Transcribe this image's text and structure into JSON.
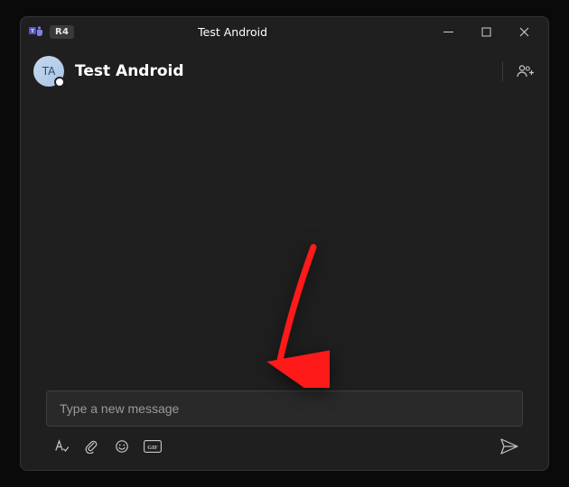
{
  "titlebar": {
    "app_badge": "R4",
    "title": "Test Android"
  },
  "chat_header": {
    "avatar_initials": "TA",
    "contact_name": "Test Android"
  },
  "composer": {
    "placeholder": "Type a new message",
    "value": ""
  },
  "icons": {
    "teams_logo": "teams-logo",
    "minimize": "minimize",
    "maximize": "maximize",
    "close": "close",
    "add_people": "add-people",
    "format": "format",
    "attach": "attach",
    "emoji": "emoji",
    "gif": "GIF",
    "send": "send"
  },
  "annotation": {
    "color": "#ff1a1a"
  }
}
